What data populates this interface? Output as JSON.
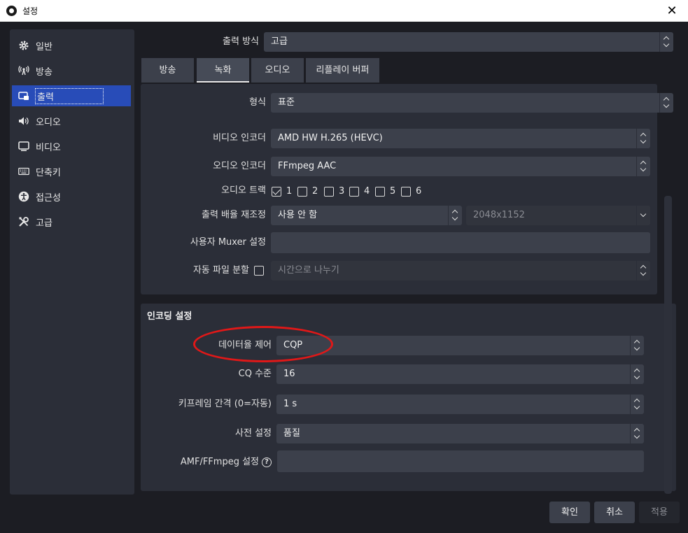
{
  "window": {
    "title": "설정",
    "close_glyph": "✕"
  },
  "sidebar": {
    "items": [
      {
        "label": "일반",
        "icon": "gear-icon"
      },
      {
        "label": "방송",
        "icon": "broadcast-icon"
      },
      {
        "label": "출력",
        "icon": "output-icon",
        "active": true
      },
      {
        "label": "오디오",
        "icon": "speaker-icon"
      },
      {
        "label": "비디오",
        "icon": "monitor-icon"
      },
      {
        "label": "단축키",
        "icon": "keyboard-icon"
      },
      {
        "label": "접근성",
        "icon": "accessibility-icon"
      },
      {
        "label": "고급",
        "icon": "tools-icon"
      }
    ]
  },
  "output_mode": {
    "label": "출력 방식",
    "value": "고급"
  },
  "tabs": [
    {
      "label": "방송"
    },
    {
      "label": "녹화",
      "active": true
    },
    {
      "label": "오디오"
    },
    {
      "label": "리플레이 버퍼"
    }
  ],
  "format_type": {
    "label": "형식",
    "value": "표준"
  },
  "recording": {
    "video_encoder": {
      "label": "비디오 인코더",
      "value": "AMD HW H.265 (HEVC)"
    },
    "audio_encoder": {
      "label": "오디오 인코더",
      "value": "FFmpeg AAC"
    },
    "audio_track": {
      "label": "오디오 트랙",
      "tracks": [
        {
          "num": "1",
          "checked": true
        },
        {
          "num": "2",
          "checked": false
        },
        {
          "num": "3",
          "checked": false
        },
        {
          "num": "4",
          "checked": false
        },
        {
          "num": "5",
          "checked": false
        },
        {
          "num": "6",
          "checked": false
        }
      ]
    },
    "rescale": {
      "label": "출력 배율 재조정",
      "value": "사용 안 함",
      "resolution": "2048x1152"
    },
    "muxer": {
      "label": "사용자 Muxer 설정",
      "value": ""
    },
    "auto_split": {
      "label": "자동 파일 분할",
      "checked": false,
      "value": "시간으로 나누기"
    }
  },
  "encoding": {
    "title": "인코딩 설정",
    "rate_control": {
      "label": "데이터율 제어",
      "value": "CQP"
    },
    "cq_level": {
      "label": "CQ 수준",
      "value": "16"
    },
    "keyframe": {
      "label": "키프레임 간격 (0=자동)",
      "value": "1 s"
    },
    "preset": {
      "label": "사전 설정",
      "value": "품질"
    },
    "amf_options": {
      "label": "AMF/FFmpeg 설정",
      "value": "",
      "help_glyph": "?"
    }
  },
  "buttons": {
    "ok": "확인",
    "cancel": "취소",
    "apply": "적용"
  },
  "colors": {
    "accent": "#284cb8",
    "highlight_ring": "#e01818"
  }
}
